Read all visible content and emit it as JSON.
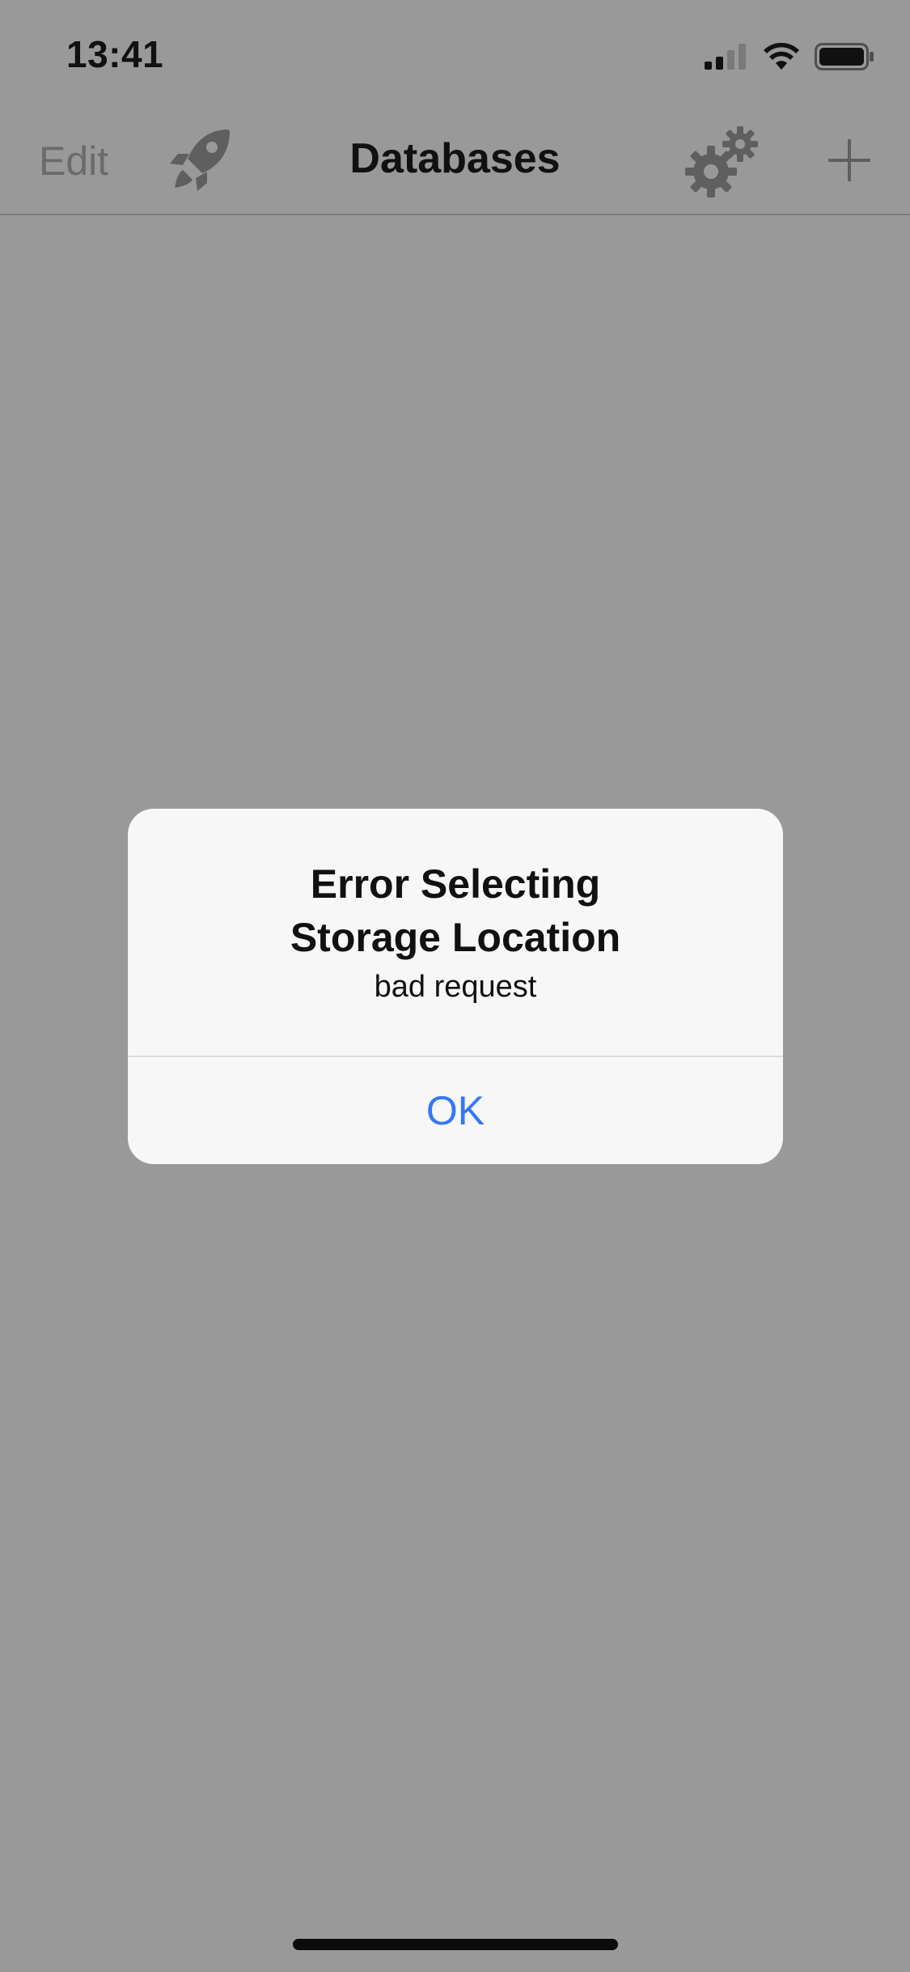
{
  "status_bar": {
    "time": "13:41",
    "icons": [
      "cellular-signal-icon",
      "wifi-icon",
      "battery-icon"
    ]
  },
  "nav_bar": {
    "edit_label": "Edit",
    "title": "Databases",
    "icons": [
      "rocket-icon",
      "gears-icon",
      "plus-icon"
    ]
  },
  "alert": {
    "title": "Error Selecting\nStorage Location",
    "message": "bad request",
    "ok_label": "OK"
  },
  "colors": {
    "background_dim": "#999999",
    "alert_bg": "#f7f7f7",
    "action_blue": "#3478f6",
    "nav_icon_gray": "#6b6b6b"
  }
}
